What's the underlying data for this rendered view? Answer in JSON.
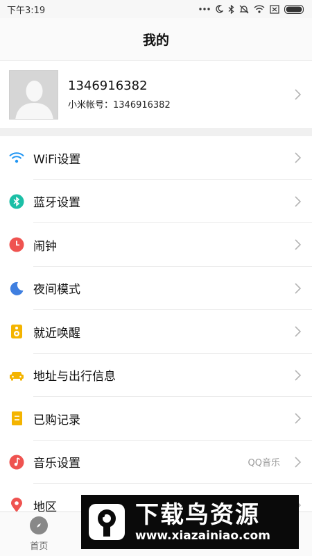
{
  "statusbar": {
    "time": "下午3:19",
    "icons": [
      "more-dots-icon",
      "moon-icon",
      "bluetooth-icon",
      "silent-icon",
      "wifi-icon",
      "no-sim-icon",
      "battery-icon"
    ]
  },
  "header": {
    "title": "我的"
  },
  "profile": {
    "name": "1346916382",
    "account": "小米帐号：1346916382"
  },
  "menu": {
    "items": [
      {
        "label": "WiFi设置",
        "icon": "wifi-icon",
        "color": "#2196f3",
        "value": ""
      },
      {
        "label": "蓝牙设置",
        "icon": "bluetooth-icon",
        "color": "#1bbfa6",
        "value": ""
      },
      {
        "label": "闹钟",
        "icon": "clock-icon",
        "color": "#ef5350",
        "value": ""
      },
      {
        "label": "夜间模式",
        "icon": "moon-icon",
        "color": "#3f7fe0",
        "value": ""
      },
      {
        "label": "就近唤醒",
        "icon": "speaker-icon",
        "color": "#f4b400",
        "value": ""
      },
      {
        "label": "地址与出行信息",
        "icon": "car-icon",
        "color": "#f4b400",
        "value": ""
      },
      {
        "label": "已购记录",
        "icon": "receipt-icon",
        "color": "#f4b400",
        "value": ""
      },
      {
        "label": "音乐设置",
        "icon": "music-icon",
        "color": "#ef5350",
        "value": "QQ音乐"
      },
      {
        "label": "地区",
        "icon": "location-pin-icon",
        "color": "#ef5350",
        "value": ""
      }
    ]
  },
  "tabs": [
    {
      "label": "首页",
      "active": false
    },
    {
      "label": "",
      "active": false
    },
    {
      "label": "",
      "active": false
    },
    {
      "label": "",
      "active": true
    }
  ],
  "watermark": {
    "title": "下载鸟资源",
    "url": "www.xiazainiao.com"
  },
  "colors": {
    "accent": "#e0393e",
    "separator": "#ececec"
  }
}
